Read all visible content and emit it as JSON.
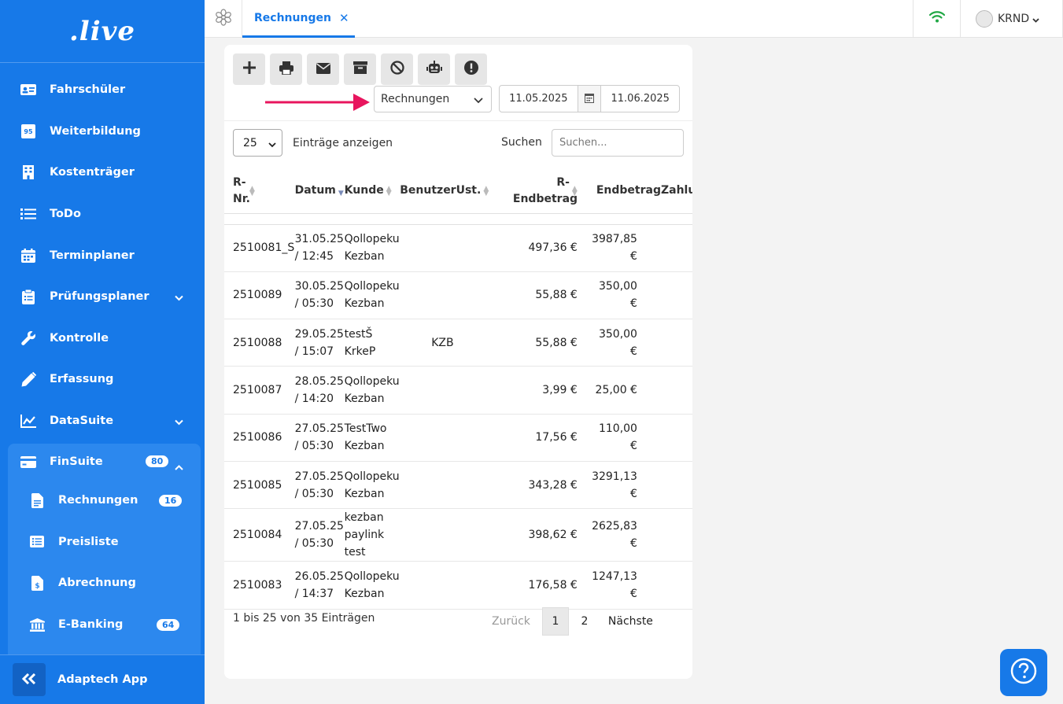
{
  "app": {
    "logo": ".live"
  },
  "sidebar": {
    "items": [
      {
        "label": "Fahrschüler",
        "icon": "id-card-icon"
      },
      {
        "label": "Weiterbildung",
        "icon": "badge-95-icon"
      },
      {
        "label": "Kostenträger",
        "icon": "building-icon"
      },
      {
        "label": "ToDo",
        "icon": "list-icon"
      },
      {
        "label": "Terminplaner",
        "icon": "calendar-icon"
      },
      {
        "label": "Prüfungsplaner",
        "icon": "clipboard-icon"
      },
      {
        "label": "Kontrolle",
        "icon": "wrench-icon"
      },
      {
        "label": "Erfassung",
        "icon": "pencil-icon"
      },
      {
        "label": "DataSuite",
        "icon": "chart-line-icon"
      }
    ],
    "finsuite": {
      "label": "FinSuite",
      "badge": "80",
      "items": [
        {
          "label": "Rechnungen",
          "badge": "16"
        },
        {
          "label": "Preisliste",
          "badge": ""
        },
        {
          "label": "Abrechnung",
          "badge": ""
        },
        {
          "label": "E-Banking",
          "badge": "64"
        }
      ]
    },
    "footer": {
      "label": "Adaptech App"
    }
  },
  "topbar": {
    "tab_label": "Rechnungen",
    "close_symbol": "✕",
    "user": "KRND"
  },
  "toolbar": {
    "buttons": [
      "plus-icon",
      "print-icon",
      "envelope-icon",
      "archive-icon",
      "ban-icon",
      "robot-icon",
      "exclamation-icon"
    ],
    "doc_type": "Rechnungen",
    "date_from": "11.05.2025",
    "date_to": "11.06.2025"
  },
  "listing": {
    "page_size": "25",
    "page_size_label": "Einträge anzeigen",
    "search_label": "Suchen",
    "search_placeholder": "Suchen..."
  },
  "table": {
    "headers": [
      "R-Nr.",
      "Datum",
      "Kunde",
      "Benutzer",
      "Ust.",
      "R-Endbetrag",
      "Endbetrag",
      "Zahlung"
    ],
    "rows": [
      {
        "nr": "2510081_S",
        "datum": "31.05.25 / 12:45",
        "kunde": "Qollopeku Kezban",
        "benutzer": "",
        "ust": "",
        "r_endbetrag": "497,36 €",
        "endbetrag": "3987,85 €"
      },
      {
        "nr": "2510089",
        "datum": "30.05.25 / 05:30",
        "kunde": "Qollopeku Kezban",
        "benutzer": "",
        "ust": "",
        "r_endbetrag": "55,88 €",
        "endbetrag": "350,00 €"
      },
      {
        "nr": "2510088",
        "datum": "29.05.25 / 15:07",
        "kunde": "testŠ KrkeP",
        "benutzer": "KZB",
        "ust": "",
        "r_endbetrag": "55,88 €",
        "endbetrag": "350,00 €"
      },
      {
        "nr": "2510087",
        "datum": "28.05.25 / 14:20",
        "kunde": "Qollopeku Kezban",
        "benutzer": "",
        "ust": "",
        "r_endbetrag": "3,99 €",
        "endbetrag": "25,00 €"
      },
      {
        "nr": "2510086",
        "datum": "27.05.25 / 05:30",
        "kunde": "TestTwo Kezban",
        "benutzer": "",
        "ust": "",
        "r_endbetrag": "17,56 €",
        "endbetrag": "110,00 €"
      },
      {
        "nr": "2510085",
        "datum": "27.05.25 / 05:30",
        "kunde": "Qollopeku Kezban",
        "benutzer": "",
        "ust": "",
        "r_endbetrag": "343,28 €",
        "endbetrag": "3291,13 €"
      },
      {
        "nr": "2510084",
        "datum": "27.05.25 / 05:30",
        "kunde": "kezban paylink test",
        "benutzer": "",
        "ust": "",
        "r_endbetrag": "398,62 €",
        "endbetrag": "2625,83 €"
      },
      {
        "nr": "2510083",
        "datum": "26.05.25 / 14:37",
        "kunde": "Qollopeku Kezban",
        "benutzer": "",
        "ust": "",
        "r_endbetrag": "176,58 €",
        "endbetrag": "1247,13 €"
      }
    ]
  },
  "footer": {
    "info": "1 bis 25 von 35 Einträgen",
    "prev": "Zurück",
    "pages": [
      "1",
      "2"
    ],
    "next": "Nächste"
  },
  "colors": {
    "primary": "#1779e8",
    "annotation_arrow": "#e8155e",
    "wifi": "#22a846"
  }
}
